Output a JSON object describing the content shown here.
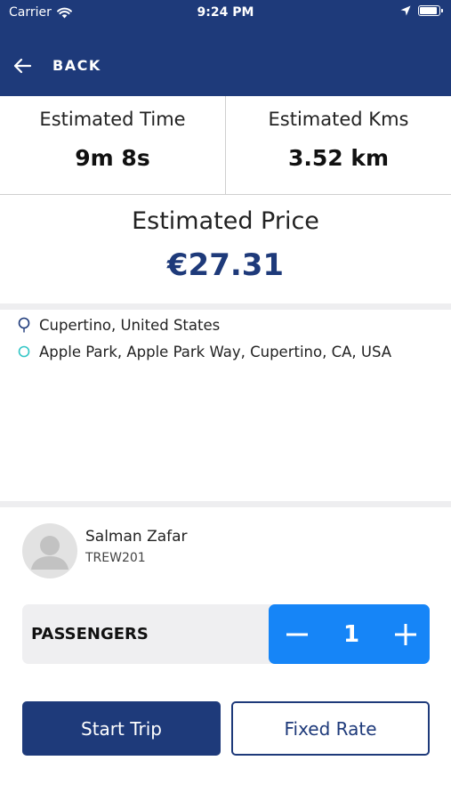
{
  "status_bar": {
    "carrier": "Carrier",
    "time": "9:24 PM"
  },
  "header": {
    "back_label": "BACK",
    "color": "#1e3a7a"
  },
  "estimates": {
    "time_label": "Estimated Time",
    "time_value": "9m 8s",
    "kms_label": "Estimated Kms",
    "kms_value": "3.52 km",
    "price_label": "Estimated Price",
    "price_value": "€27.31"
  },
  "route": {
    "origin": "Cupertino, United States",
    "destination": "Apple Park, Apple Park Way, Cupertino, CA, USA",
    "origin_icon": "pin-icon",
    "destination_icon": "circle-icon"
  },
  "driver": {
    "name": "Salman Zafar",
    "code": "TREW201",
    "avatar_icon": "person-avatar-icon"
  },
  "passengers": {
    "label": "PASSENGERS",
    "value": "1",
    "stepper_color": "#1685f7"
  },
  "actions": {
    "start_label": "Start Trip",
    "fixed_label": "Fixed Rate"
  }
}
